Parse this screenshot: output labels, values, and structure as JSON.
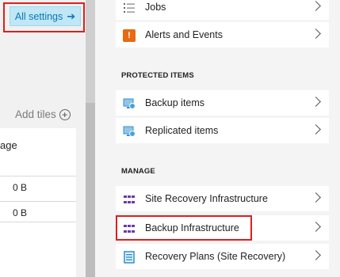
{
  "left_blade": {
    "settings_button": "All settings",
    "add_tiles": "Add tiles",
    "tile": {
      "title_partial": "age",
      "rows": [
        "0 B",
        "0 B"
      ]
    }
  },
  "right_blade": {
    "top_items": [
      {
        "label": "Jobs",
        "icon": "list-icon"
      },
      {
        "label": "Alerts and Events",
        "icon": "alert-icon"
      }
    ],
    "sections": [
      {
        "title": "PROTECTED ITEMS",
        "items": [
          {
            "label": "Backup items",
            "icon": "backup-item-icon"
          },
          {
            "label": "Replicated items",
            "icon": "replicated-item-icon"
          }
        ]
      },
      {
        "title": "MANAGE",
        "items": [
          {
            "label": "Site Recovery Infrastructure",
            "icon": "grid-icon"
          },
          {
            "label": "Backup Infrastructure",
            "icon": "grid-icon"
          },
          {
            "label": "Recovery Plans (Site Recovery)",
            "icon": "plan-icon"
          }
        ]
      }
    ]
  },
  "colors": {
    "accent_button_bg": "#bfe7f5",
    "accent_text": "#0b78b7",
    "highlight_border": "#e01d1d",
    "alert_icon": "#e86a12",
    "grid_icon": "#6b3aa8"
  }
}
